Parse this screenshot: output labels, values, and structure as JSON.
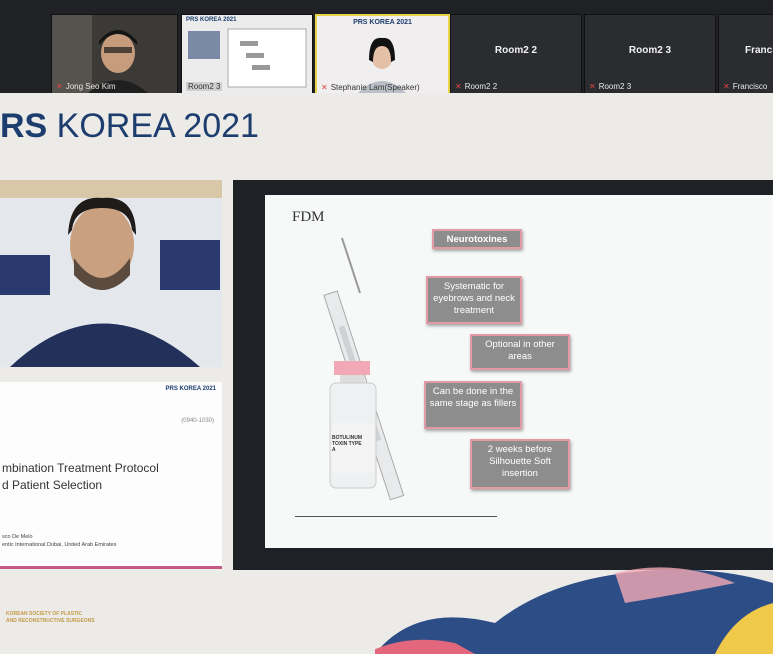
{
  "participants": [
    {
      "name": "Jong Seo Kim"
    },
    {
      "name": "Room2 3",
      "slide_logo": "PRS KOREA 2021"
    },
    {
      "name": "Stephanie Lam(Speaker)",
      "slide_logo": "PRS KOREA 2021"
    },
    {
      "name": "Room2 2",
      "label": "Room2 2"
    },
    {
      "name": "Room2 3",
      "label": "Room2 3"
    },
    {
      "name": "Francisco",
      "label": "Francis"
    }
  ],
  "conference": {
    "prefix": "RS",
    "suffix": " KOREA 2021"
  },
  "left_slide": {
    "header": "PRS KOREA 2021",
    "time": "(0940-1030)",
    "title_line1": "mbination Treatment Protocol",
    "title_line2": "d Patient Selection",
    "author_line1": "sco De Melo",
    "author_line2": "entic International Dubai, United Arab Emirates"
  },
  "main_slide": {
    "brand": "FDM",
    "boxes": [
      {
        "text": "Neurotoxines"
      },
      {
        "text": "Systematic for eyebrows and neck treatment"
      },
      {
        "text": "Optional in other areas"
      },
      {
        "text": "Can be done in the same stage as fillers"
      },
      {
        "text": "2 weeks before Silhouette Soft insertion"
      }
    ],
    "vial_label": "BOTULINUM TOXIN TYPE A"
  },
  "society": {
    "line1": "KOREAN SOCIETY OF PLASTIC",
    "line2": "AND RECONSTRUCTIVE SURGEONS"
  }
}
